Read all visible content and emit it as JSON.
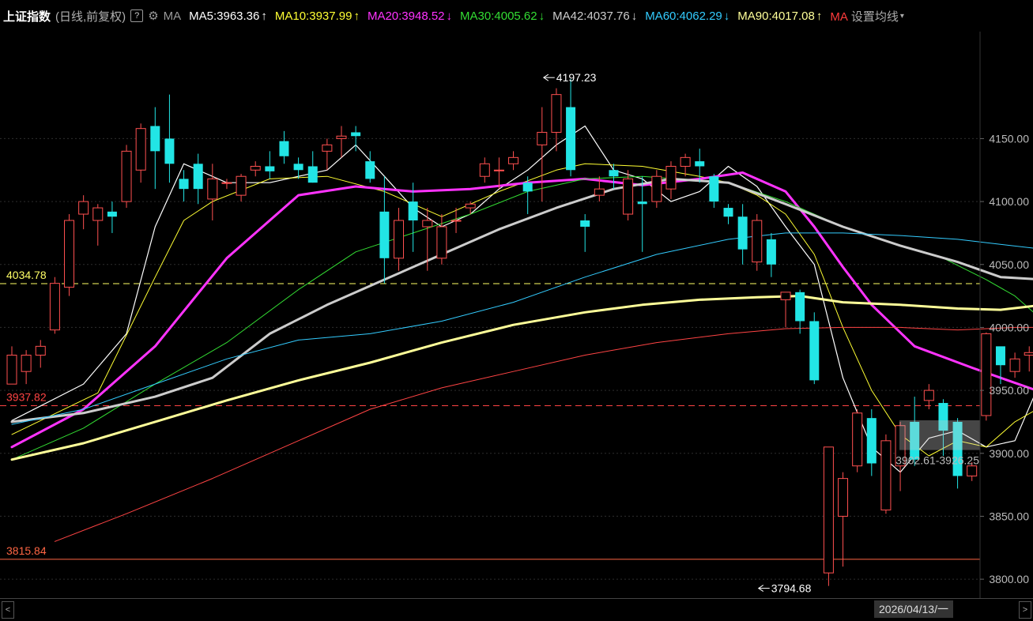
{
  "header": {
    "title": "上证指数",
    "subtitle": "(日线,前复权)",
    "help_icon": "?",
    "settings_icon": "gear-icon",
    "ma_label": "MA",
    "ma_items": [
      {
        "label": "MA5:3963.36",
        "arrow": "↑",
        "color": "#ffffff"
      },
      {
        "label": "MA10:3937.99",
        "arrow": "↑",
        "color": "#ffff33"
      },
      {
        "label": "MA20:3948.52",
        "arrow": "↓",
        "color": "#ff33ff"
      },
      {
        "label": "MA30:4005.62",
        "arrow": "↓",
        "color": "#33dd33"
      },
      {
        "label": "MA42:4037.76",
        "arrow": "↓",
        "color": "#cccccc"
      },
      {
        "label": "MA60:4062.29",
        "arrow": "↓",
        "color": "#33ccff"
      },
      {
        "label": "MA90:4017.08",
        "arrow": "↑",
        "color": "#ffff99"
      }
    ],
    "settings_ma": "MA",
    "settings_label": "设置均线",
    "dropdown": "▾"
  },
  "chart_data": {
    "type": "candlestick",
    "y_ticks": [
      "4150.00",
      "4100.00",
      "4050.00",
      "4000.00",
      "3950.00",
      "3900.00",
      "3850.00",
      "3800.00"
    ],
    "ylim": [
      3785,
      4235
    ],
    "levels": [
      {
        "value": 4034.78,
        "label": "4034.78",
        "color": "#ffff66",
        "style": "dashed"
      },
      {
        "value": 3937.82,
        "label": "3937.82",
        "color": "#ff4444",
        "style": "dashed"
      },
      {
        "value": 3815.84,
        "label": "3815.84",
        "color": "#ff6644",
        "style": "solid"
      }
    ],
    "annotations": [
      {
        "label": "4197.23",
        "value": 4197.23,
        "bar": 37
      },
      {
        "label": "3794.68",
        "value": 3794.68,
        "bar": 52
      }
    ],
    "range_box": {
      "label": "3902.61-3926.25",
      "low": 3902.61,
      "high": 3926.25
    },
    "candles": [
      [
        3955,
        3978,
        3955,
        3985
      ],
      [
        3965,
        3978,
        3955,
        3982
      ],
      [
        3978,
        3985,
        3968,
        3990
      ],
      [
        3998,
        4035,
        3995,
        4040
      ],
      [
        4032,
        4085,
        4025,
        4090
      ],
      [
        4090,
        4100,
        4078,
        4105
      ],
      [
        4085,
        4095,
        4065,
        4098
      ],
      [
        4092,
        4088,
        4075,
        4100
      ],
      [
        4100,
        4140,
        4095,
        4145
      ],
      [
        4125,
        4158,
        4115,
        4162
      ],
      [
        4160,
        4140,
        4110,
        4175
      ],
      [
        4150,
        4130,
        4115,
        4185
      ],
      [
        4118,
        4110,
        4100,
        4125
      ],
      [
        4130,
        4110,
        4098,
        4138
      ],
      [
        4102,
        4118,
        4085,
        4130
      ],
      [
        4115,
        4115,
        4110,
        4118
      ],
      [
        4105,
        4120,
        4100,
        4122
      ],
      [
        4125,
        4128,
        4120,
        4132
      ],
      [
        4128,
        4124,
        4118,
        4140
      ],
      [
        4148,
        4136,
        4130,
        4156
      ],
      [
        4130,
        4125,
        4118,
        4135
      ],
      [
        4128,
        4115,
        4115,
        4140
      ],
      [
        4140,
        4145,
        4125,
        4150
      ],
      [
        4150,
        4152,
        4135,
        4160
      ],
      [
        4155,
        4152,
        4140,
        4160
      ],
      [
        4132,
        4118,
        4115,
        4140
      ],
      [
        4092,
        4055,
        4035,
        4120
      ],
      [
        4055,
        4085,
        4045,
        4095
      ],
      [
        4100,
        4085,
        4060,
        4115
      ],
      [
        4080,
        4085,
        4045,
        4095
      ],
      [
        4055,
        4080,
        4050,
        4090
      ],
      [
        4085,
        4085,
        4075,
        4095
      ],
      [
        4095,
        4098,
        4090,
        4100
      ],
      [
        4120,
        4130,
        4115,
        4135
      ],
      [
        4125,
        4125,
        4110,
        4135
      ],
      [
        4130,
        4135,
        4125,
        4140
      ],
      [
        4115,
        4108,
        4090,
        4120
      ],
      [
        4145,
        4155,
        4100,
        4175
      ],
      [
        4155,
        4185,
        4140,
        4190
      ],
      [
        4175,
        4125,
        4120,
        4197.23
      ],
      [
        4085,
        4080,
        4060,
        4090
      ],
      [
        4105,
        4110,
        4100,
        4120
      ],
      [
        4125,
        4120,
        4110,
        4130
      ],
      [
        4090,
        4118,
        4085,
        4125
      ],
      [
        4100,
        4098,
        4060,
        4120
      ],
      [
        4100,
        4120,
        4095,
        4125
      ],
      [
        4110,
        4128,
        4102,
        4132
      ],
      [
        4128,
        4135,
        4120,
        4138
      ],
      [
        4132,
        4128,
        4115,
        4142
      ],
      [
        4120,
        4100,
        4095,
        4122
      ],
      [
        4095,
        4088,
        4082,
        4098
      ],
      [
        4088,
        4062,
        4050,
        4098
      ],
      [
        4052,
        4085,
        4045,
        4090
      ],
      [
        4070,
        4050,
        4040,
        4075
      ],
      [
        4022,
        4028,
        4000,
        4028
      ],
      [
        4028,
        4005,
        3995,
        4030
      ],
      [
        4005,
        3958,
        3955,
        4012
      ],
      [
        3805,
        3905,
        3794.68,
        3905
      ],
      [
        3850,
        3880,
        3810,
        3885
      ],
      [
        3890,
        3932,
        3885,
        3935
      ],
      [
        3928,
        3892,
        3882,
        3935
      ],
      [
        3855,
        3910,
        3852,
        3915
      ],
      [
        3890,
        3922,
        3870,
        3925
      ],
      [
        3925,
        3895,
        3890,
        3945
      ],
      [
        3942,
        3950,
        3935,
        3955
      ],
      [
        3940,
        3918,
        3898,
        3943
      ],
      [
        3925,
        3882,
        3872,
        3928
      ],
      [
        3882,
        3890,
        3878,
        3893
      ],
      [
        3930,
        3995,
        3926,
        3996
      ],
      [
        3985,
        3970,
        3955,
        3978
      ],
      [
        3965,
        3975,
        3960,
        3980
      ],
      [
        3978,
        3980,
        3965,
        3985
      ],
      [
        3972,
        3978,
        3968,
        3984
      ]
    ],
    "bar_colors": {
      "up": "#ff5050",
      "down": "#22e5e5"
    },
    "ma_series": [
      {
        "name": "MA5",
        "color": "#ffffff",
        "width": 1.2,
        "values": [
          [
            0,
            3926
          ],
          [
            5,
            3955
          ],
          [
            8,
            3995
          ],
          [
            10,
            4080
          ],
          [
            12,
            4130
          ],
          [
            15,
            4115
          ],
          [
            18,
            4115
          ],
          [
            22,
            4125
          ],
          [
            24,
            4145
          ],
          [
            26,
            4120
          ],
          [
            28,
            4095
          ],
          [
            30,
            4080
          ],
          [
            32,
            4090
          ],
          [
            34,
            4110
          ],
          [
            36,
            4125
          ],
          [
            38,
            4145
          ],
          [
            40,
            4160
          ],
          [
            42,
            4125
          ],
          [
            44,
            4118
          ],
          [
            46,
            4100
          ],
          [
            48,
            4108
          ],
          [
            50,
            4128
          ],
          [
            52,
            4112
          ],
          [
            54,
            4080
          ],
          [
            56,
            4050
          ],
          [
            58,
            3960
          ],
          [
            60,
            3905
          ],
          [
            62,
            3885
          ],
          [
            64,
            3912
          ],
          [
            66,
            3918
          ],
          [
            68,
            3905
          ],
          [
            70,
            3910
          ],
          [
            72,
            3963
          ]
        ]
      },
      {
        "name": "MA10",
        "color": "#ffff33",
        "width": 1,
        "values": [
          [
            0,
            3915
          ],
          [
            6,
            3948
          ],
          [
            10,
            4040
          ],
          [
            12,
            4085
          ],
          [
            14,
            4100
          ],
          [
            18,
            4118
          ],
          [
            22,
            4120
          ],
          [
            26,
            4108
          ],
          [
            30,
            4088
          ],
          [
            34,
            4108
          ],
          [
            38,
            4125
          ],
          [
            40,
            4130
          ],
          [
            44,
            4128
          ],
          [
            48,
            4120
          ],
          [
            50,
            4115
          ],
          [
            52,
            4105
          ],
          [
            54,
            4090
          ],
          [
            56,
            4058
          ],
          [
            58,
            4000
          ],
          [
            60,
            3950
          ],
          [
            62,
            3915
          ],
          [
            64,
            3898
          ],
          [
            66,
            3910
          ],
          [
            68,
            3905
          ],
          [
            70,
            3925
          ],
          [
            72,
            3938
          ]
        ]
      },
      {
        "name": "MA20",
        "color": "#ff33ff",
        "width": 3,
        "values": [
          [
            0,
            3905
          ],
          [
            5,
            3935
          ],
          [
            10,
            3985
          ],
          [
            15,
            4055
          ],
          [
            20,
            4105
          ],
          [
            24,
            4112
          ],
          [
            28,
            4108
          ],
          [
            32,
            4110
          ],
          [
            36,
            4115
          ],
          [
            40,
            4118
          ],
          [
            44,
            4113
          ],
          [
            48,
            4118
          ],
          [
            51,
            4123
          ],
          [
            54,
            4108
          ],
          [
            56,
            4080
          ],
          [
            58,
            4048
          ],
          [
            60,
            4018
          ],
          [
            63,
            3985
          ],
          [
            67,
            3968
          ],
          [
            69,
            3960
          ],
          [
            72,
            3948
          ]
        ]
      },
      {
        "name": "MA30",
        "color": "#33dd33",
        "width": 1,
        "values": [
          [
            0,
            3895
          ],
          [
            5,
            3920
          ],
          [
            10,
            3955
          ],
          [
            15,
            3988
          ],
          [
            20,
            4030
          ],
          [
            24,
            4060
          ],
          [
            28,
            4075
          ],
          [
            32,
            4090
          ],
          [
            36,
            4108
          ],
          [
            40,
            4118
          ],
          [
            44,
            4120
          ],
          [
            50,
            4115
          ],
          [
            54,
            4100
          ],
          [
            58,
            4080
          ],
          [
            62,
            4065
          ],
          [
            65,
            4055
          ],
          [
            68,
            4038
          ],
          [
            70,
            4025
          ],
          [
            72,
            4005
          ]
        ]
      },
      {
        "name": "MA42",
        "color": "#cccccc",
        "width": 3,
        "values": [
          [
            0,
            3925
          ],
          [
            5,
            3932
          ],
          [
            10,
            3945
          ],
          [
            14,
            3960
          ],
          [
            18,
            3995
          ],
          [
            22,
            4018
          ],
          [
            26,
            4038
          ],
          [
            30,
            4058
          ],
          [
            34,
            4078
          ],
          [
            38,
            4095
          ],
          [
            42,
            4110
          ],
          [
            46,
            4118
          ],
          [
            50,
            4115
          ],
          [
            54,
            4098
          ],
          [
            58,
            4080
          ],
          [
            62,
            4065
          ],
          [
            66,
            4052
          ],
          [
            69,
            4040
          ],
          [
            72,
            4038
          ]
        ]
      },
      {
        "name": "MA60",
        "color": "#33ccff",
        "width": 1,
        "values": [
          [
            0,
            3923
          ],
          [
            5,
            3935
          ],
          [
            10,
            3955
          ],
          [
            15,
            3975
          ],
          [
            20,
            3990
          ],
          [
            25,
            3995
          ],
          [
            30,
            4005
          ],
          [
            35,
            4020
          ],
          [
            40,
            4040
          ],
          [
            45,
            4058
          ],
          [
            50,
            4070
          ],
          [
            54,
            4075
          ],
          [
            58,
            4075
          ],
          [
            62,
            4073
          ],
          [
            66,
            4070
          ],
          [
            72,
            4062
          ]
        ]
      },
      {
        "name": "MA90",
        "color": "#ffff99",
        "width": 3,
        "values": [
          [
            0,
            3895
          ],
          [
            5,
            3908
          ],
          [
            10,
            3925
          ],
          [
            15,
            3942
          ],
          [
            20,
            3958
          ],
          [
            25,
            3972
          ],
          [
            30,
            3988
          ],
          [
            35,
            4002
          ],
          [
            40,
            4012
          ],
          [
            44,
            4018
          ],
          [
            48,
            4022
          ],
          [
            52,
            4024
          ],
          [
            55,
            4025
          ],
          [
            58,
            4020
          ],
          [
            62,
            4018
          ],
          [
            66,
            4015
          ],
          [
            69,
            4014
          ],
          [
            72,
            4018
          ]
        ]
      },
      {
        "name": "MA",
        "color": "#ff4444",
        "width": 1,
        "values": [
          [
            3,
            3830
          ],
          [
            8,
            3852
          ],
          [
            14,
            3880
          ],
          [
            20,
            3910
          ],
          [
            25,
            3935
          ],
          [
            30,
            3952
          ],
          [
            35,
            3965
          ],
          [
            40,
            3978
          ],
          [
            45,
            3988
          ],
          [
            50,
            3995
          ],
          [
            54,
            3999
          ],
          [
            58,
            4000
          ],
          [
            62,
            4000
          ],
          [
            66,
            3998
          ],
          [
            70,
            4000
          ],
          [
            72,
            4000
          ]
        ]
      }
    ]
  },
  "footer": {
    "date_badge": "2026/04/13/一",
    "scroll_left": "<",
    "scroll_right": ">"
  }
}
